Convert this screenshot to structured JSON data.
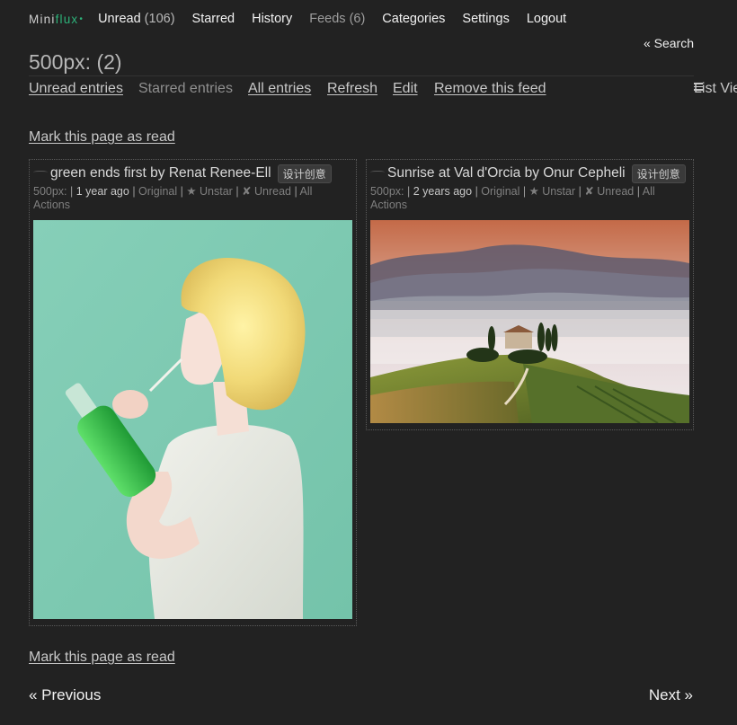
{
  "header": {
    "logo_prefix": "Mini",
    "logo_flux": "flux",
    "logo_dot": "•",
    "nav": [
      {
        "label": "Unread",
        "count": "(106)"
      },
      {
        "label": "Starred",
        "count": ""
      },
      {
        "label": "History",
        "count": ""
      },
      {
        "label": "Feeds",
        "count": "(6)"
      },
      {
        "label": "Categories",
        "count": ""
      },
      {
        "label": "Settings",
        "count": ""
      },
      {
        "label": "Logout",
        "count": ""
      }
    ],
    "search_label": "« Search"
  },
  "page": {
    "title": "500px: (2)",
    "subnav": {
      "unread_entries": "Unread entries",
      "starred_entries": "Starred entries",
      "all_entries": "All entries",
      "refresh": "Refresh",
      "edit": "Edit",
      "remove_feed": "Remove this feed",
      "list_view": "List View"
    },
    "mark_read_label": "Mark this page as read"
  },
  "entries": [
    {
      "title": "green ends first by Renat Renee-Ell",
      "tag": "设计创意",
      "feed": "500px:",
      "time": "1 year ago",
      "original": "Original",
      "star": "★ Unstar",
      "unread": "✘ Unread",
      "all_actions": "All Actions",
      "image_subject": "blonde-girl-drinking-green-bottle-photo"
    },
    {
      "title": "Sunrise at Val d'Orcia by Onur Cepheli",
      "tag": "设计创意",
      "feed": "500px:",
      "time": "2 years ago",
      "original": "Original",
      "star": "★ Unstar",
      "unread": "✘ Unread",
      "all_actions": "All Actions",
      "image_subject": "tuscany-misty-hills-sunrise-photo"
    }
  ],
  "pagination": {
    "previous": "« Previous",
    "next": "Next »"
  },
  "colors": {
    "background": "#222222",
    "accent": "#2db37a"
  }
}
